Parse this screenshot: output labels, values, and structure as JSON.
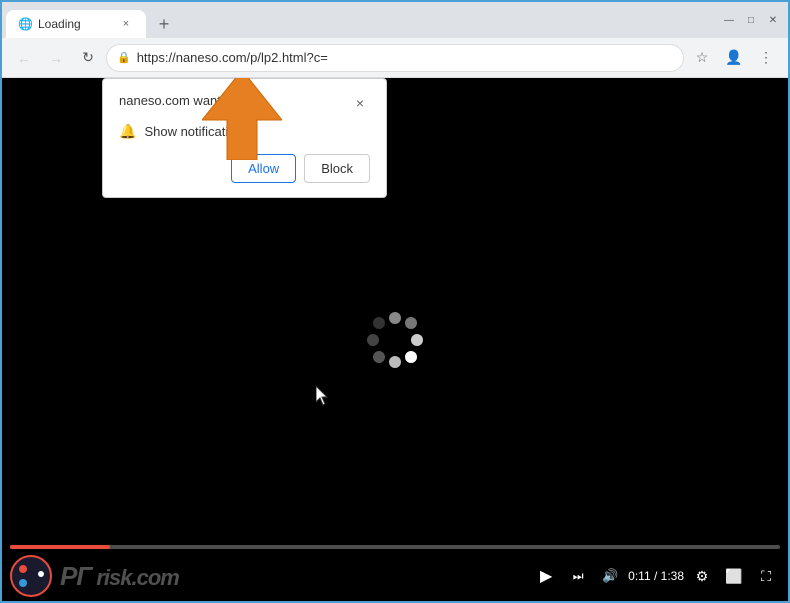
{
  "browser": {
    "tab": {
      "favicon": "🌐",
      "title": "Loading",
      "close_label": "×"
    },
    "new_tab_label": "+",
    "window_controls": {
      "minimize": "—",
      "maximize": "□",
      "close": "✕"
    },
    "nav": {
      "back_label": "←",
      "forward_label": "→",
      "reload_label": "↻",
      "url": "https://naneso.com/p/lp2.html?c=",
      "bookmark_label": "☆",
      "profile_label": "👤",
      "menu_label": "⋮"
    }
  },
  "popup": {
    "title": "naneso.com wants to",
    "close_label": "×",
    "item": {
      "icon": "🔔",
      "text": "Show notifications"
    },
    "allow_label": "Allow",
    "block_label": "Block"
  },
  "video": {
    "watermark": "PC risk.com",
    "time_current": "0:11",
    "time_total": "1:38",
    "progress_percent": 13
  },
  "spinner": {
    "dots": 8
  }
}
